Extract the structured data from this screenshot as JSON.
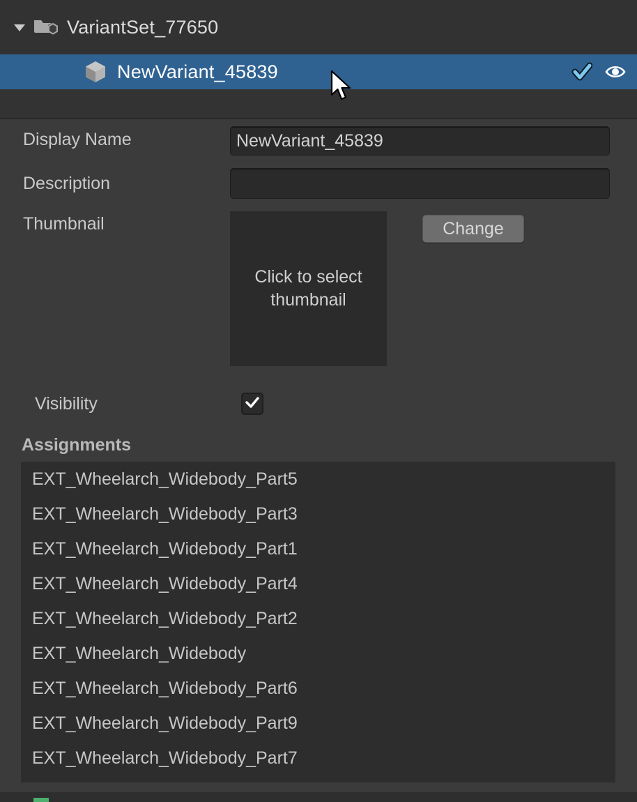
{
  "outliner": {
    "variant_set": {
      "name": "VariantSet_77650",
      "icon": "folder-cube-icon",
      "disclosure_icon": "chevron-down-icon",
      "expanded": true
    },
    "variant": {
      "name": "NewVariant_45839",
      "icon": "cube-icon",
      "selected": true,
      "actions": [
        {
          "icon": "check-icon",
          "color": "#7fc8ef"
        },
        {
          "icon": "eye-icon",
          "color": "#ffffff"
        }
      ]
    },
    "selection_color": "#2f6291"
  },
  "details": {
    "display_name": {
      "label": "Display Name",
      "value": "NewVariant_45839",
      "placeholder": ""
    },
    "description": {
      "label": "Description",
      "value": "",
      "placeholder": ""
    },
    "thumbnail": {
      "label": "Thumbnail",
      "empty_text": "Click to select thumbnail",
      "change_button": "Change"
    },
    "visibility": {
      "label": "Visibility",
      "checked": true,
      "check_icon": "check-icon"
    },
    "assignments": {
      "title": "Assignments",
      "items": [
        "EXT_Wheelarch_Widebody_Part5",
        "EXT_Wheelarch_Widebody_Part3",
        "EXT_Wheelarch_Widebody_Part1",
        "EXT_Wheelarch_Widebody_Part4",
        "EXT_Wheelarch_Widebody_Part2",
        "EXT_Wheelarch_Widebody",
        "EXT_Wheelarch_Widebody_Part6",
        "EXT_Wheelarch_Widebody_Part9",
        "EXT_Wheelarch_Widebody_Part7"
      ]
    }
  },
  "status": {
    "accent_color": "#4caf6d"
  },
  "cursor": {
    "icon": "arrow-pointer-icon"
  }
}
